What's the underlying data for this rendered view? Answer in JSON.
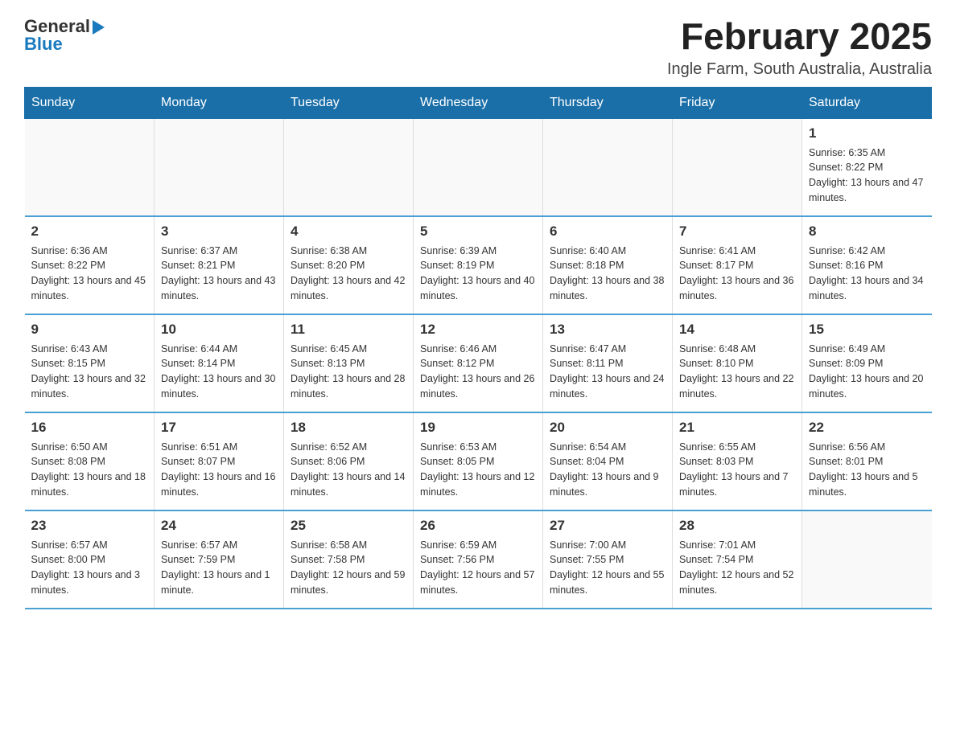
{
  "header": {
    "logo_general": "General",
    "logo_blue": "Blue",
    "title": "February 2025",
    "subtitle": "Ingle Farm, South Australia, Australia"
  },
  "calendar": {
    "days_of_week": [
      "Sunday",
      "Monday",
      "Tuesday",
      "Wednesday",
      "Thursday",
      "Friday",
      "Saturday"
    ],
    "weeks": [
      [
        {
          "day": "",
          "info": ""
        },
        {
          "day": "",
          "info": ""
        },
        {
          "day": "",
          "info": ""
        },
        {
          "day": "",
          "info": ""
        },
        {
          "day": "",
          "info": ""
        },
        {
          "day": "",
          "info": ""
        },
        {
          "day": "1",
          "info": "Sunrise: 6:35 AM\nSunset: 8:22 PM\nDaylight: 13 hours and 47 minutes."
        }
      ],
      [
        {
          "day": "2",
          "info": "Sunrise: 6:36 AM\nSunset: 8:22 PM\nDaylight: 13 hours and 45 minutes."
        },
        {
          "day": "3",
          "info": "Sunrise: 6:37 AM\nSunset: 8:21 PM\nDaylight: 13 hours and 43 minutes."
        },
        {
          "day": "4",
          "info": "Sunrise: 6:38 AM\nSunset: 8:20 PM\nDaylight: 13 hours and 42 minutes."
        },
        {
          "day": "5",
          "info": "Sunrise: 6:39 AM\nSunset: 8:19 PM\nDaylight: 13 hours and 40 minutes."
        },
        {
          "day": "6",
          "info": "Sunrise: 6:40 AM\nSunset: 8:18 PM\nDaylight: 13 hours and 38 minutes."
        },
        {
          "day": "7",
          "info": "Sunrise: 6:41 AM\nSunset: 8:17 PM\nDaylight: 13 hours and 36 minutes."
        },
        {
          "day": "8",
          "info": "Sunrise: 6:42 AM\nSunset: 8:16 PM\nDaylight: 13 hours and 34 minutes."
        }
      ],
      [
        {
          "day": "9",
          "info": "Sunrise: 6:43 AM\nSunset: 8:15 PM\nDaylight: 13 hours and 32 minutes."
        },
        {
          "day": "10",
          "info": "Sunrise: 6:44 AM\nSunset: 8:14 PM\nDaylight: 13 hours and 30 minutes."
        },
        {
          "day": "11",
          "info": "Sunrise: 6:45 AM\nSunset: 8:13 PM\nDaylight: 13 hours and 28 minutes."
        },
        {
          "day": "12",
          "info": "Sunrise: 6:46 AM\nSunset: 8:12 PM\nDaylight: 13 hours and 26 minutes."
        },
        {
          "day": "13",
          "info": "Sunrise: 6:47 AM\nSunset: 8:11 PM\nDaylight: 13 hours and 24 minutes."
        },
        {
          "day": "14",
          "info": "Sunrise: 6:48 AM\nSunset: 8:10 PM\nDaylight: 13 hours and 22 minutes."
        },
        {
          "day": "15",
          "info": "Sunrise: 6:49 AM\nSunset: 8:09 PM\nDaylight: 13 hours and 20 minutes."
        }
      ],
      [
        {
          "day": "16",
          "info": "Sunrise: 6:50 AM\nSunset: 8:08 PM\nDaylight: 13 hours and 18 minutes."
        },
        {
          "day": "17",
          "info": "Sunrise: 6:51 AM\nSunset: 8:07 PM\nDaylight: 13 hours and 16 minutes."
        },
        {
          "day": "18",
          "info": "Sunrise: 6:52 AM\nSunset: 8:06 PM\nDaylight: 13 hours and 14 minutes."
        },
        {
          "day": "19",
          "info": "Sunrise: 6:53 AM\nSunset: 8:05 PM\nDaylight: 13 hours and 12 minutes."
        },
        {
          "day": "20",
          "info": "Sunrise: 6:54 AM\nSunset: 8:04 PM\nDaylight: 13 hours and 9 minutes."
        },
        {
          "day": "21",
          "info": "Sunrise: 6:55 AM\nSunset: 8:03 PM\nDaylight: 13 hours and 7 minutes."
        },
        {
          "day": "22",
          "info": "Sunrise: 6:56 AM\nSunset: 8:01 PM\nDaylight: 13 hours and 5 minutes."
        }
      ],
      [
        {
          "day": "23",
          "info": "Sunrise: 6:57 AM\nSunset: 8:00 PM\nDaylight: 13 hours and 3 minutes."
        },
        {
          "day": "24",
          "info": "Sunrise: 6:57 AM\nSunset: 7:59 PM\nDaylight: 13 hours and 1 minute."
        },
        {
          "day": "25",
          "info": "Sunrise: 6:58 AM\nSunset: 7:58 PM\nDaylight: 12 hours and 59 minutes."
        },
        {
          "day": "26",
          "info": "Sunrise: 6:59 AM\nSunset: 7:56 PM\nDaylight: 12 hours and 57 minutes."
        },
        {
          "day": "27",
          "info": "Sunrise: 7:00 AM\nSunset: 7:55 PM\nDaylight: 12 hours and 55 minutes."
        },
        {
          "day": "28",
          "info": "Sunrise: 7:01 AM\nSunset: 7:54 PM\nDaylight: 12 hours and 52 minutes."
        },
        {
          "day": "",
          "info": ""
        }
      ]
    ]
  }
}
